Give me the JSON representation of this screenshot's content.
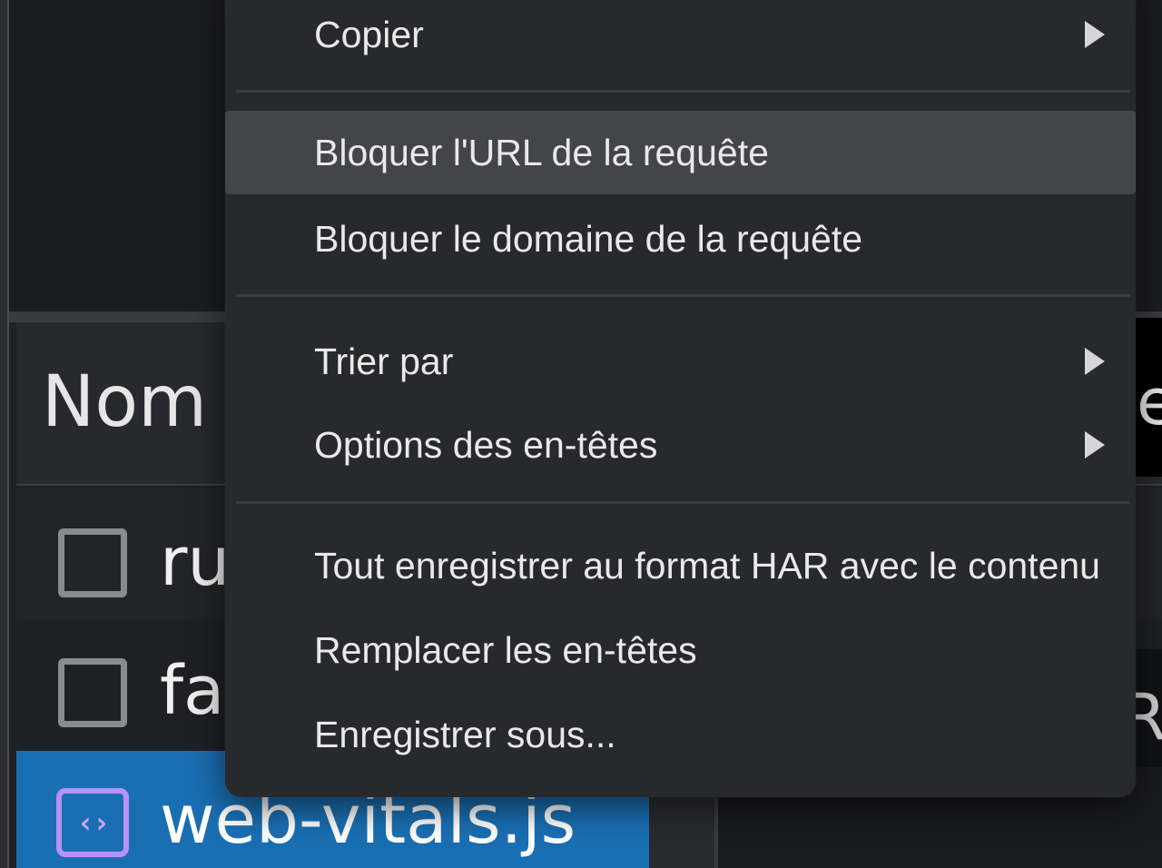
{
  "network_panel": {
    "column_header": "Nom",
    "right_header_fragment": "e",
    "right_row_fragment": "RE",
    "rows": [
      {
        "name": "ru",
        "selected": false,
        "icon": "checkbox"
      },
      {
        "name": "fa",
        "selected": false,
        "icon": "checkbox"
      },
      {
        "name": "web-vitals.js",
        "selected": true,
        "icon": "code-file-icon"
      }
    ],
    "file_icon_glyph": "‹›"
  },
  "context_menu": {
    "items": [
      {
        "label": "Copier",
        "has_submenu": true,
        "hovered": false
      },
      {
        "label": "Bloquer l'URL de la requête",
        "has_submenu": false,
        "hovered": true
      },
      {
        "label": "Bloquer le domaine de la requête",
        "has_submenu": false,
        "hovered": false
      },
      {
        "label": "Trier par",
        "has_submenu": true,
        "hovered": false
      },
      {
        "label": "Options des en-têtes",
        "has_submenu": true,
        "hovered": false
      },
      {
        "label": "Tout enregistrer au format HAR avec le contenu",
        "has_submenu": false,
        "hovered": false
      },
      {
        "label": "Remplacer les en-têtes",
        "has_submenu": false,
        "hovered": false
      },
      {
        "label": "Enregistrer sous...",
        "has_submenu": false,
        "hovered": false
      }
    ]
  },
  "colors": {
    "selection": "#1a6fb3",
    "menu_background": "#28292c",
    "menu_hover": "#444548",
    "file_icon": "#b792f7"
  }
}
